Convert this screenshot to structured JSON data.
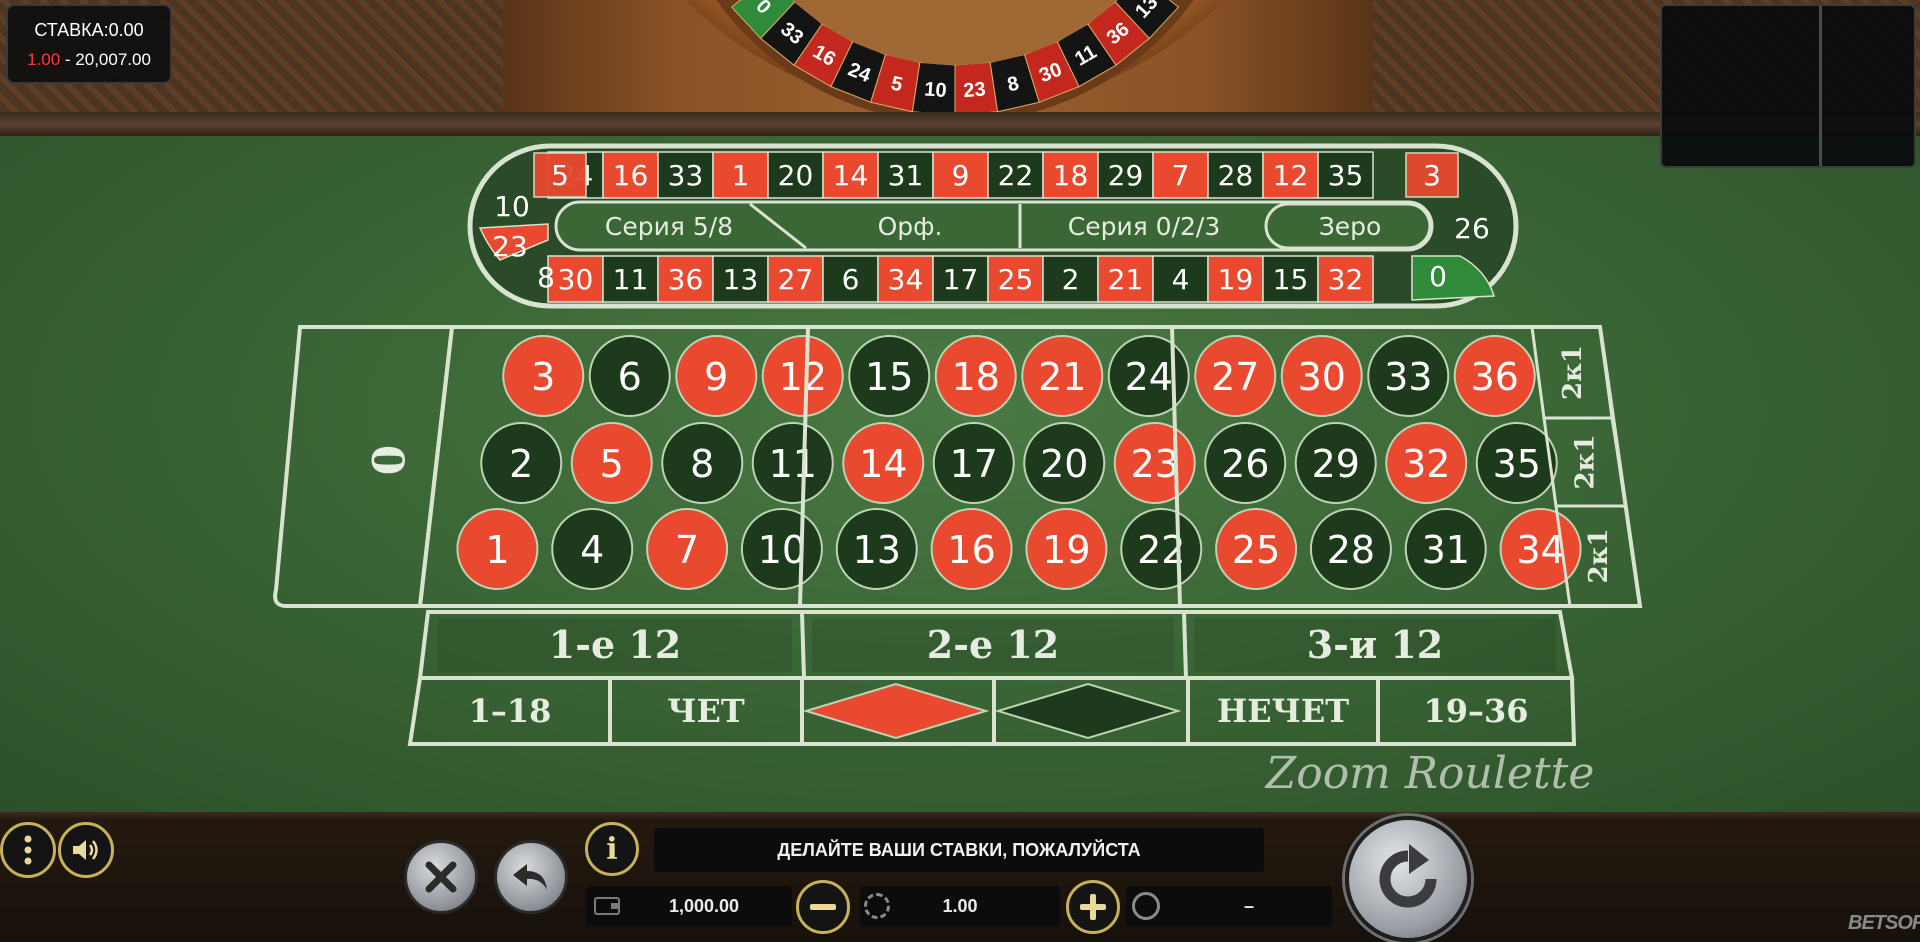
{
  "header": {
    "bet_label": "СТАВКА:",
    "bet_value": "0.00",
    "limit_min": "1.00",
    "limit_separator": " - ",
    "limit_max": "20,007.00"
  },
  "wheel": {
    "visible_numbers": [
      "0",
      "33",
      "16",
      "24",
      "5",
      "10",
      "23",
      "8",
      "30",
      "11",
      "36",
      "13"
    ]
  },
  "racetrack": {
    "top_row": [
      "5",
      "24",
      "16",
      "33",
      "1",
      "20",
      "14",
      "31",
      "9",
      "22",
      "18",
      "29",
      "7",
      "28",
      "12",
      "35",
      "3"
    ],
    "bottom_row": [
      "8",
      "30",
      "11",
      "36",
      "13",
      "27",
      "6",
      "34",
      "17",
      "25",
      "2",
      "21",
      "4",
      "19",
      "15",
      "32",
      "0"
    ],
    "left": [
      "10",
      "23"
    ],
    "right": "26",
    "sections": {
      "tiers": "Серия 5/8",
      "orphans": "Орф.",
      "voisins": "Серия 0/2/3",
      "zero": "Зеро"
    }
  },
  "table": {
    "zero": "0",
    "rows": [
      [
        "3",
        "6",
        "9",
        "12",
        "15",
        "18",
        "21",
        "24",
        "27",
        "30",
        "33",
        "36"
      ],
      [
        "2",
        "5",
        "8",
        "11",
        "14",
        "17",
        "20",
        "23",
        "26",
        "29",
        "32",
        "35"
      ],
      [
        "1",
        "4",
        "7",
        "10",
        "13",
        "16",
        "19",
        "22",
        "25",
        "28",
        "31",
        "34"
      ]
    ],
    "red_numbers": [
      "1",
      "3",
      "5",
      "7",
      "9",
      "12",
      "14",
      "16",
      "18",
      "19",
      "21",
      "23",
      "25",
      "27",
      "30",
      "32",
      "34",
      "36"
    ],
    "column_bets": [
      "2к1",
      "2к1",
      "2к1"
    ],
    "dozens": [
      "1-е 12",
      "2-е 12",
      "3-и 12"
    ],
    "outside": [
      "1–18",
      "ЧЕТ",
      "НЕЧЕТ",
      "19–36"
    ],
    "logo": "Zoom Roulette"
  },
  "controls": {
    "message": "ДЕЛАЙТЕ ВАШИ СТАВКИ, ПОЖАЛУЙСТА",
    "balance": "1,000.00",
    "stake": "1.00",
    "win": "–",
    "info_label": "i"
  },
  "brand": "BETSOFT",
  "colors": {
    "red": "#e8492f",
    "black": "#1e3a1c",
    "felt": "#3b6636",
    "line": "#d8e4d0",
    "gold": "#c7b25a"
  }
}
